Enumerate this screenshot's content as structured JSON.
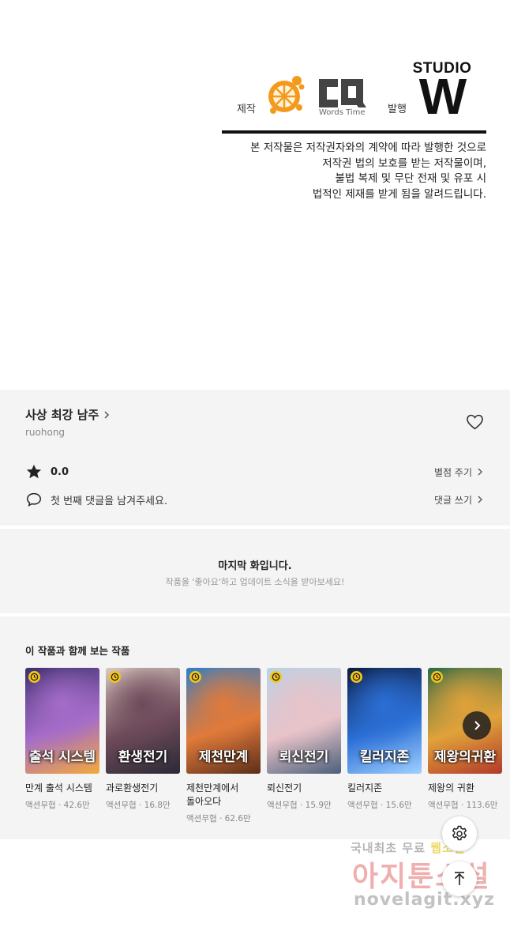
{
  "credits": {
    "make_label": "제작",
    "publish_label": "발행",
    "cq_logo_text": "CQ",
    "cq_logo_sub": "Words Time",
    "studio_word": "STUDIO",
    "studio_letter": "W",
    "notice_lines": [
      "본 저작물은 저작권자와의 계약에 따라 발행한 것으로",
      "저작권 법의 보호를 받는 저작물이며,",
      "불법 복제 및 무단 전재 및 유포 시",
      "법적인 제재를 받게 됨을 알려드립니다."
    ]
  },
  "work": {
    "title": "사상 최강 남주",
    "author": "ruohong",
    "rating": "0.0",
    "rate_action": "별점 주기",
    "comment_prompt": "첫 번째 댓글을 남겨주세요.",
    "comment_action": "댓글 쓰기"
  },
  "last_episode": {
    "title": "마지막 화입니다.",
    "subtitle": "작품을 '좋아요'하고 업데이트 소식을 받아보세요!"
  },
  "recommendations": {
    "heading": "이 작품과 함께 보는 작품",
    "items": [
      {
        "title": "만계 출석 시스템",
        "meta": "액션무협 · 42.6만",
        "cover_text": "출석 시스템",
        "colors": [
          "#3b2f6b",
          "#a56cc9",
          "#f2a93b"
        ]
      },
      {
        "title": "과로환생전기",
        "meta": "액션무협 · 16.8만",
        "cover_text": "환생전기",
        "colors": [
          "#d9c8c0",
          "#6e4a5a",
          "#2a2a35"
        ]
      },
      {
        "title": "제천만계에서 돌아오다",
        "meta": "액션무협 · 62.6만",
        "cover_text": "제천만계",
        "colors": [
          "#2f7fc9",
          "#e07a3a",
          "#5b2e1a"
        ]
      },
      {
        "title": "뢰신전기",
        "meta": "액션무협 · 15.9만",
        "cover_text": "뢰신전기",
        "colors": [
          "#b8d3e6",
          "#e8c3c9",
          "#4a5f7a"
        ]
      },
      {
        "title": "킬러지존",
        "meta": "액션무협 · 15.6만",
        "cover_text": "킬러지존",
        "colors": [
          "#0d1b3d",
          "#2b6fd6",
          "#9fd0ff"
        ]
      },
      {
        "title": "제왕의 귀환",
        "meta": "액션무협 · 113.6만",
        "cover_text": "제왕의귀환",
        "colors": [
          "#2d6b4a",
          "#e0a23a",
          "#b23a2a"
        ]
      }
    ]
  },
  "watermark": {
    "line1_a": "국내최초 무료 ",
    "line1_b": "웹소설",
    "line2": "아지툰소설",
    "line3": "novelagit.xyz"
  },
  "icons": {
    "heart": "heart-icon",
    "star": "star-icon",
    "comment": "comment-icon",
    "clock": "clock-icon",
    "next": "chevron-right-icon",
    "settings": "gear-icon",
    "scroll_top": "arrow-up-icon"
  }
}
